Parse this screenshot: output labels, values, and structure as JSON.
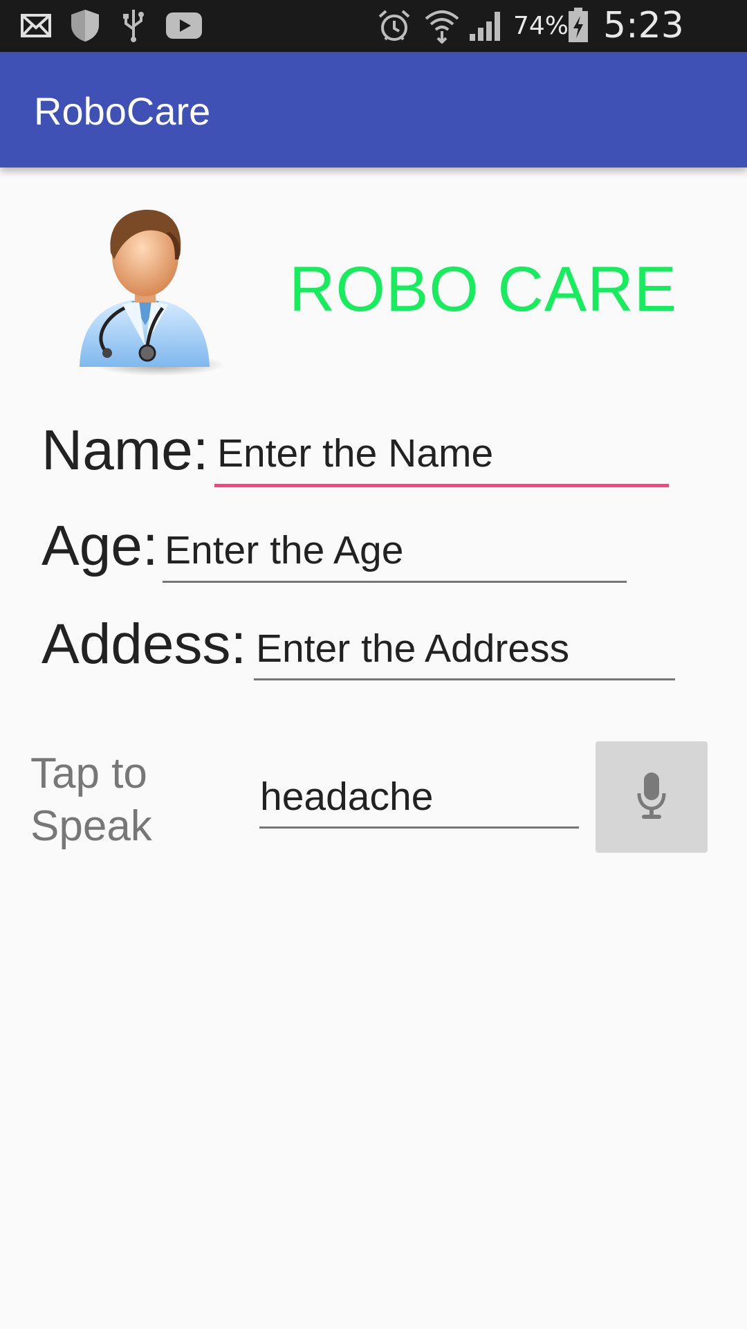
{
  "status_bar": {
    "icons": [
      "mail-icon",
      "shield-icon",
      "usb-icon",
      "youtube-icon",
      "alarm-icon",
      "wifi-icon",
      "signal-icon",
      "battery-charging-icon"
    ],
    "battery_percent": "74%",
    "time": "5:23 PM"
  },
  "app_bar": {
    "title": "RoboCare"
  },
  "header": {
    "brand": "ROBO CARE",
    "brand_color": "#17ec5c",
    "image": "doctor-avatar"
  },
  "form": {
    "name_label": "Name:",
    "name_placeholder": "Enter the Name",
    "age_label": "Age:",
    "age_placeholder": "Enter the Age",
    "address_label": "Addess:",
    "address_placeholder": "Enter the Address"
  },
  "speech": {
    "tap_label_line1": "Tap to",
    "tap_label_line2": "Speak",
    "result_value": "headache",
    "mic_icon": "microphone-icon"
  },
  "colors": {
    "primary": "#3f51b5",
    "accent": "#ff4081"
  }
}
